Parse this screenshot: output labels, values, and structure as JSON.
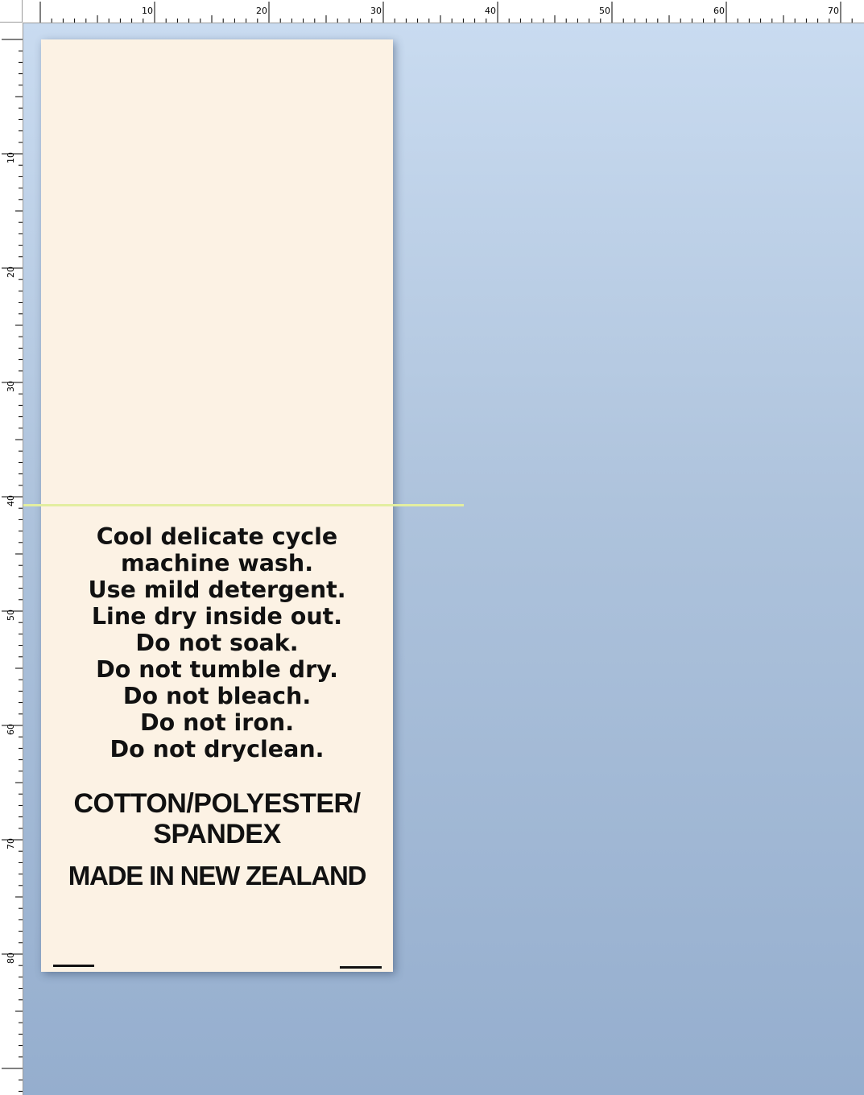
{
  "rulers": {
    "top_labels": [
      "10",
      "20",
      "30",
      "40",
      "50",
      "60",
      "70"
    ],
    "left_labels": [
      "10",
      "20",
      "30",
      "40",
      "50",
      "60",
      "70",
      "80"
    ]
  },
  "label": {
    "care_instructions": [
      "Cool delicate cycle",
      "machine wash.",
      "Use mild detergent.",
      "Line dry inside out.",
      "Do not soak.",
      "Do not tumble dry.",
      "Do not bleach.",
      "Do not iron.",
      "Do not dryclean."
    ],
    "composition_line1": "COTTON/POLYESTER/",
    "composition_line2": "SPANDEX",
    "origin": "MADE IN NEW ZEALAND"
  },
  "colors": {
    "label_background": "#fcf2e4",
    "canvas_top": "#c9dbf0",
    "canvas_bottom": "#95aece",
    "guide_line": "#e3eea0"
  }
}
